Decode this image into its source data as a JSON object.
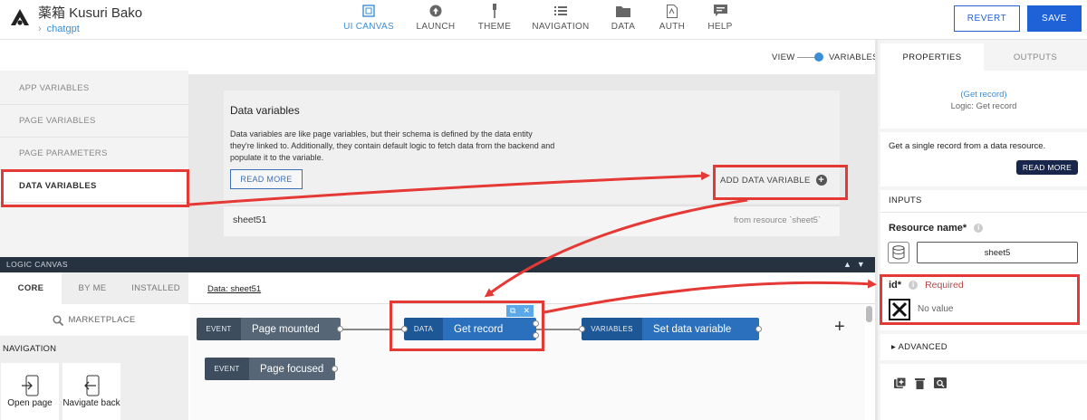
{
  "app": {
    "title": "薬箱 Kusuri Bako",
    "breadcrumb": "chatgpt"
  },
  "topnav": [
    {
      "label": "UI CANVAS",
      "icon": "ui-canvas-icon",
      "active": true
    },
    {
      "label": "LAUNCH",
      "icon": "launch-icon"
    },
    {
      "label": "THEME",
      "icon": "theme-brush-icon"
    },
    {
      "label": "NAVIGATION",
      "icon": "navigation-list-icon"
    },
    {
      "label": "DATA",
      "icon": "data-folder-icon"
    },
    {
      "label": "AUTH",
      "icon": "auth-icon"
    },
    {
      "label": "HELP",
      "icon": "help-chat-icon"
    }
  ],
  "actions": {
    "revert": "REVERT",
    "save": "SAVE"
  },
  "variables_sidebar": [
    "APP VARIABLES",
    "PAGE VARIABLES",
    "PAGE PARAMETERS",
    "DATA VARIABLES"
  ],
  "view_toggle": {
    "left": "VIEW",
    "right": "VARIABLES"
  },
  "data_variables": {
    "title": "Data variables",
    "description": "Data variables are like page variables, but their schema is defined by the data entity they're linked to. Additionally, they contain default logic to fetch data from the backend and populate it to the variable.",
    "read_more": "READ MORE",
    "add_button": "ADD DATA VARIABLE",
    "row": {
      "name": "sheet51",
      "source": "from resource `sheet5`"
    }
  },
  "logic_canvas": {
    "bar_label": "LOGIC CANVAS",
    "arrows": "▲▼",
    "tabs": [
      "CORE",
      "BY ME",
      "INSTALLED"
    ],
    "marketplace": "MARKETPLACE",
    "nav_header": "NAVIGATION",
    "nav_items": [
      "Open page",
      "Navigate back"
    ],
    "title": "Data: sheet51",
    "nodes": [
      {
        "tag": "EVENT",
        "name": "Page mounted"
      },
      {
        "tag": "EVENT",
        "name": "Page focused"
      },
      {
        "tag": "DATA",
        "name": "Get record"
      },
      {
        "tag": "VARIABLES",
        "name": "Set data variable"
      }
    ],
    "add_symbol": "+"
  },
  "properties": {
    "tabs": [
      "PROPERTIES",
      "OUTPUTS"
    ],
    "node_link": "(Get record)",
    "node_sub": "Logic: Get record",
    "description": "Get a single record from a data resource.",
    "read_more": "READ MORE",
    "inputs_header": "INPUTS",
    "resource_label": "Resource name*",
    "resource_value": "sheet5",
    "id_label": "id*",
    "required": "Required",
    "no_value": "No value",
    "advanced": "ADVANCED"
  },
  "colors": {
    "primary": "#1f62d8",
    "annotation_red": "#e53935",
    "node_blue": "#2a70bd",
    "node_gray": "#566677"
  }
}
